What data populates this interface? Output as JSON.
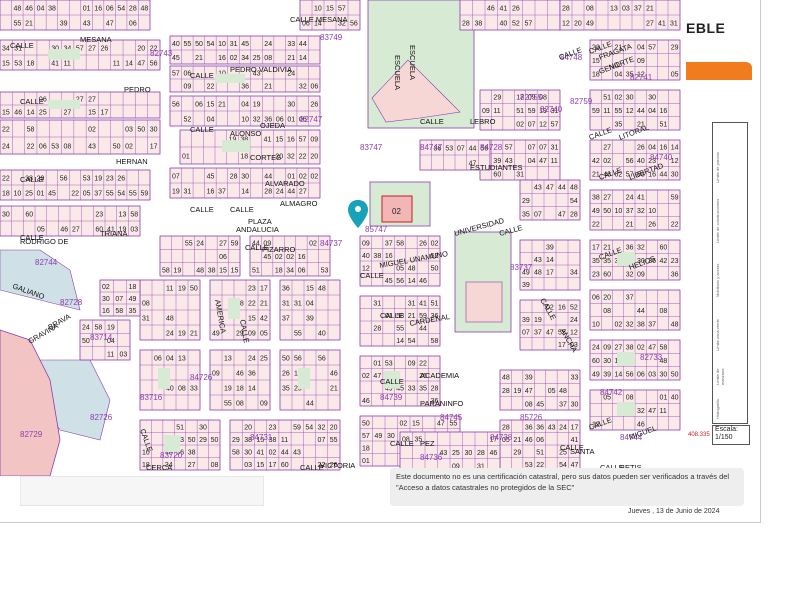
{
  "header": {
    "title_fragment": "EBLE",
    "accent_color": "#f07c1e"
  },
  "map": {
    "colors": {
      "background": "#ffffff",
      "parcel_fill": "#fbe9e9",
      "parcel_stroke": "#8a3fb0",
      "green": "#d7ead4",
      "blue": "#cfe0e6",
      "block_label": "#8a3fb0",
      "pin": "#17a2b8"
    },
    "streets": [
      "CALLE",
      "MESANA",
      "CALLE",
      "PEDRO",
      "CALLE",
      "HERNAN",
      "CORTES",
      "CALLE",
      "ALMAGRO",
      "CALLE",
      "RODRIGO DE",
      "TRIANA",
      "GALIANO",
      "CALLE MESANA",
      "CALLE",
      "PEDRO VALDIVIA",
      "CALLE",
      "ALONSO",
      "OJEDA",
      "CALLE",
      "ALVARADO",
      "PLAZA",
      "ANDALUCIA",
      "CALLE",
      "PIZARRO",
      "AMERICA",
      "CALLE",
      "BRAVA",
      "GRAVINA",
      "CALLE",
      "CERCA",
      "CALLE",
      "LEBRO",
      "ESTUDIANTES",
      "CALLE",
      "UNIVERSIDAD",
      "CALLE",
      "MIGUEL UNAMUNO",
      "CALLE",
      "CARDENAL",
      "CALLE",
      "ACADEMIA",
      "PARANINFO",
      "CALLE",
      "PEZ",
      "CALLE",
      "VICTORIA",
      "ESCUELA",
      "ESCUELA",
      "CALLE",
      "GENIL",
      "CALLE",
      "FRAGATA",
      "NORTE",
      "CALLE",
      "LITORAL",
      "CALLE",
      "LIBERTAD",
      "CALLE",
      "HELIOS",
      "CALLE",
      "MIGUEL",
      "CALLE",
      "ANCHA",
      "CALLE",
      "SANTA",
      "CALLE",
      "BETIS"
    ],
    "block_numbers": [
      "82755",
      "82759",
      "82740",
      "82747",
      "82741",
      "82743",
      "84737",
      "83747",
      "84747",
      "82744",
      "83714",
      "82726",
      "82729",
      "83720",
      "83716",
      "83737",
      "84740",
      "82733",
      "84742",
      "84748",
      "84738",
      "84745",
      "84739",
      "85747",
      "84736",
      "84731",
      "83749",
      "84728",
      "85726",
      "82728",
      "84726",
      "84744"
    ],
    "parcel_numbers": [
      "01",
      "02",
      "03",
      "04",
      "05",
      "06",
      "07",
      "08",
      "09",
      "10",
      "11",
      "12",
      "13",
      "14",
      "15",
      "16",
      "17",
      "18",
      "19",
      "20",
      "21",
      "22",
      "23",
      "24",
      "25",
      "26",
      "27",
      "28",
      "29",
      "30",
      "31",
      "32",
      "33",
      "34",
      "35",
      "36",
      "37",
      "38",
      "39",
      "40",
      "41",
      "42",
      "43",
      "44",
      "45",
      "46",
      "47",
      "48",
      "49",
      "50",
      "51",
      "52",
      "53",
      "54",
      "55",
      "56",
      "57",
      "58",
      "59",
      "60"
    ],
    "pin_label": "location-pin",
    "parcel_highlight": "02"
  },
  "legend": {
    "items": [
      "Límite de parcela",
      "Límite de construcciones",
      "Mobiliario y aceras",
      "Límite zona verde",
      "Límite de manzana",
      "Hidrografía"
    ],
    "footer": "Límite en esta parcela"
  },
  "scale": {
    "label": "Escala:",
    "value": "1/150"
  },
  "coords_text": "408.335",
  "notice": "Este documento no es una certificación catastral, pero sus datos pueden ser verificados a través del \"Acceso a datos catastrales no protegidos de la SEC\"",
  "date": "Jueves , 13 de Junio de 2024"
}
